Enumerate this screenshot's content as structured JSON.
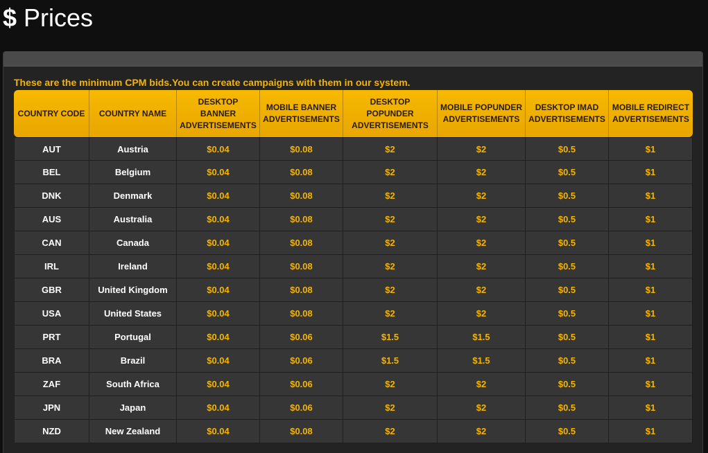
{
  "page": {
    "title": "Prices",
    "title_icon": "$",
    "note": "These are the minimum CPM bids.You can create campaigns with them in our system."
  },
  "colors": {
    "accent": "#f5b400",
    "header_bg": "#f3b300",
    "row_bg": "#363636",
    "page_bg": "#0f0f0f"
  },
  "table": {
    "columns": [
      "COUNTRY CODE",
      "COUNTRY NAME",
      "DESKTOP BANNER ADVERTISEMENTS",
      "MOBILE BANNER ADVERTISEMENTS",
      "DESKTOP POPUNDER ADVERTISEMENTS",
      "MOBILE POPUNDER ADVERTISEMENTS",
      "DESKTOP IMAD ADVERTISEMENTS",
      "MOBILE REDIRECT ADVERTISEMENTS"
    ],
    "rows": [
      [
        "AUT",
        "Austria",
        "$0.04",
        "$0.08",
        "$2",
        "$2",
        "$0.5",
        "$1"
      ],
      [
        "BEL",
        "Belgium",
        "$0.04",
        "$0.08",
        "$2",
        "$2",
        "$0.5",
        "$1"
      ],
      [
        "DNK",
        "Denmark",
        "$0.04",
        "$0.08",
        "$2",
        "$2",
        "$0.5",
        "$1"
      ],
      [
        "AUS",
        "Australia",
        "$0.04",
        "$0.08",
        "$2",
        "$2",
        "$0.5",
        "$1"
      ],
      [
        "CAN",
        "Canada",
        "$0.04",
        "$0.08",
        "$2",
        "$2",
        "$0.5",
        "$1"
      ],
      [
        "IRL",
        "Ireland",
        "$0.04",
        "$0.08",
        "$2",
        "$2",
        "$0.5",
        "$1"
      ],
      [
        "GBR",
        "United Kingdom",
        "$0.04",
        "$0.08",
        "$2",
        "$2",
        "$0.5",
        "$1"
      ],
      [
        "USA",
        "United States",
        "$0.04",
        "$0.08",
        "$2",
        "$2",
        "$0.5",
        "$1"
      ],
      [
        "PRT",
        "Portugal",
        "$0.04",
        "$0.06",
        "$1.5",
        "$1.5",
        "$0.5",
        "$1"
      ],
      [
        "BRA",
        "Brazil",
        "$0.04",
        "$0.06",
        "$1.5",
        "$1.5",
        "$0.5",
        "$1"
      ],
      [
        "ZAF",
        "South Africa",
        "$0.04",
        "$0.06",
        "$2",
        "$2",
        "$0.5",
        "$1"
      ],
      [
        "JPN",
        "Japan",
        "$0.04",
        "$0.06",
        "$2",
        "$2",
        "$0.5",
        "$1"
      ],
      [
        "NZD",
        "New Zealand",
        "$0.04",
        "$0.08",
        "$2",
        "$2",
        "$0.5",
        "$1"
      ]
    ]
  }
}
